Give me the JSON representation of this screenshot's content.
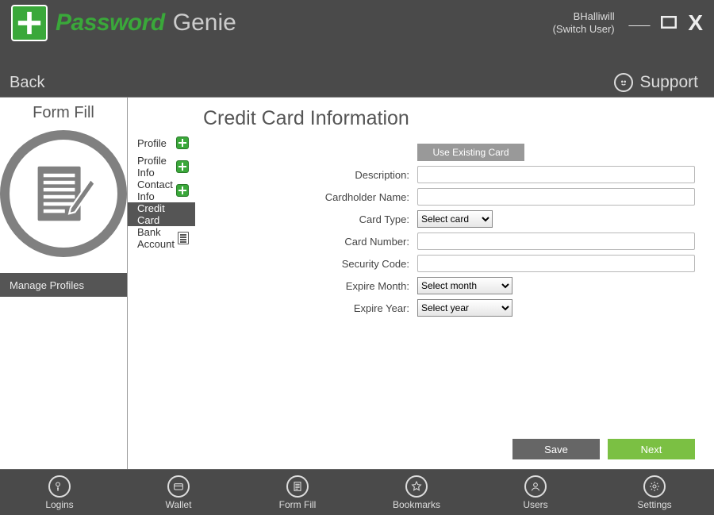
{
  "app": {
    "brand1": "Password",
    "brand2": "Genie"
  },
  "user": {
    "name": "BHalliwill",
    "switch": "(Switch User)"
  },
  "subbar": {
    "back": "Back",
    "support": "Support"
  },
  "sidebar": {
    "title": "Form Fill",
    "manage": "Manage Profiles"
  },
  "midnav": {
    "items": [
      {
        "label": "Profile",
        "icon": "add",
        "active": false
      },
      {
        "label": "Profile Info",
        "icon": "add",
        "active": false
      },
      {
        "label": "Contact Info",
        "icon": "add",
        "active": false
      },
      {
        "label": "Credit Card",
        "icon": "",
        "active": true
      },
      {
        "label": "Bank Account",
        "icon": "list",
        "active": false
      }
    ]
  },
  "content": {
    "heading": "Credit Card Information",
    "useExisting": "Use Existing Card",
    "labels": {
      "description": "Description:",
      "cardholder": "Cardholder Name:",
      "cardType": "Card Type:",
      "cardNumber": "Card Number:",
      "securityCode": "Security Code:",
      "expMonth": "Expire Month:",
      "expYear": "Expire Year:"
    },
    "selects": {
      "cardType": "Select card",
      "expMonth": "Select month",
      "expYear": "Select year"
    },
    "values": {
      "description": "",
      "cardholder": "",
      "cardNumber": "",
      "securityCode": ""
    },
    "buttons": {
      "save": "Save",
      "next": "Next"
    }
  },
  "bottomnav": {
    "items": [
      {
        "label": "Logins"
      },
      {
        "label": "Wallet"
      },
      {
        "label": "Form Fill"
      },
      {
        "label": "Bookmarks"
      },
      {
        "label": "Users"
      },
      {
        "label": "Settings"
      }
    ]
  }
}
